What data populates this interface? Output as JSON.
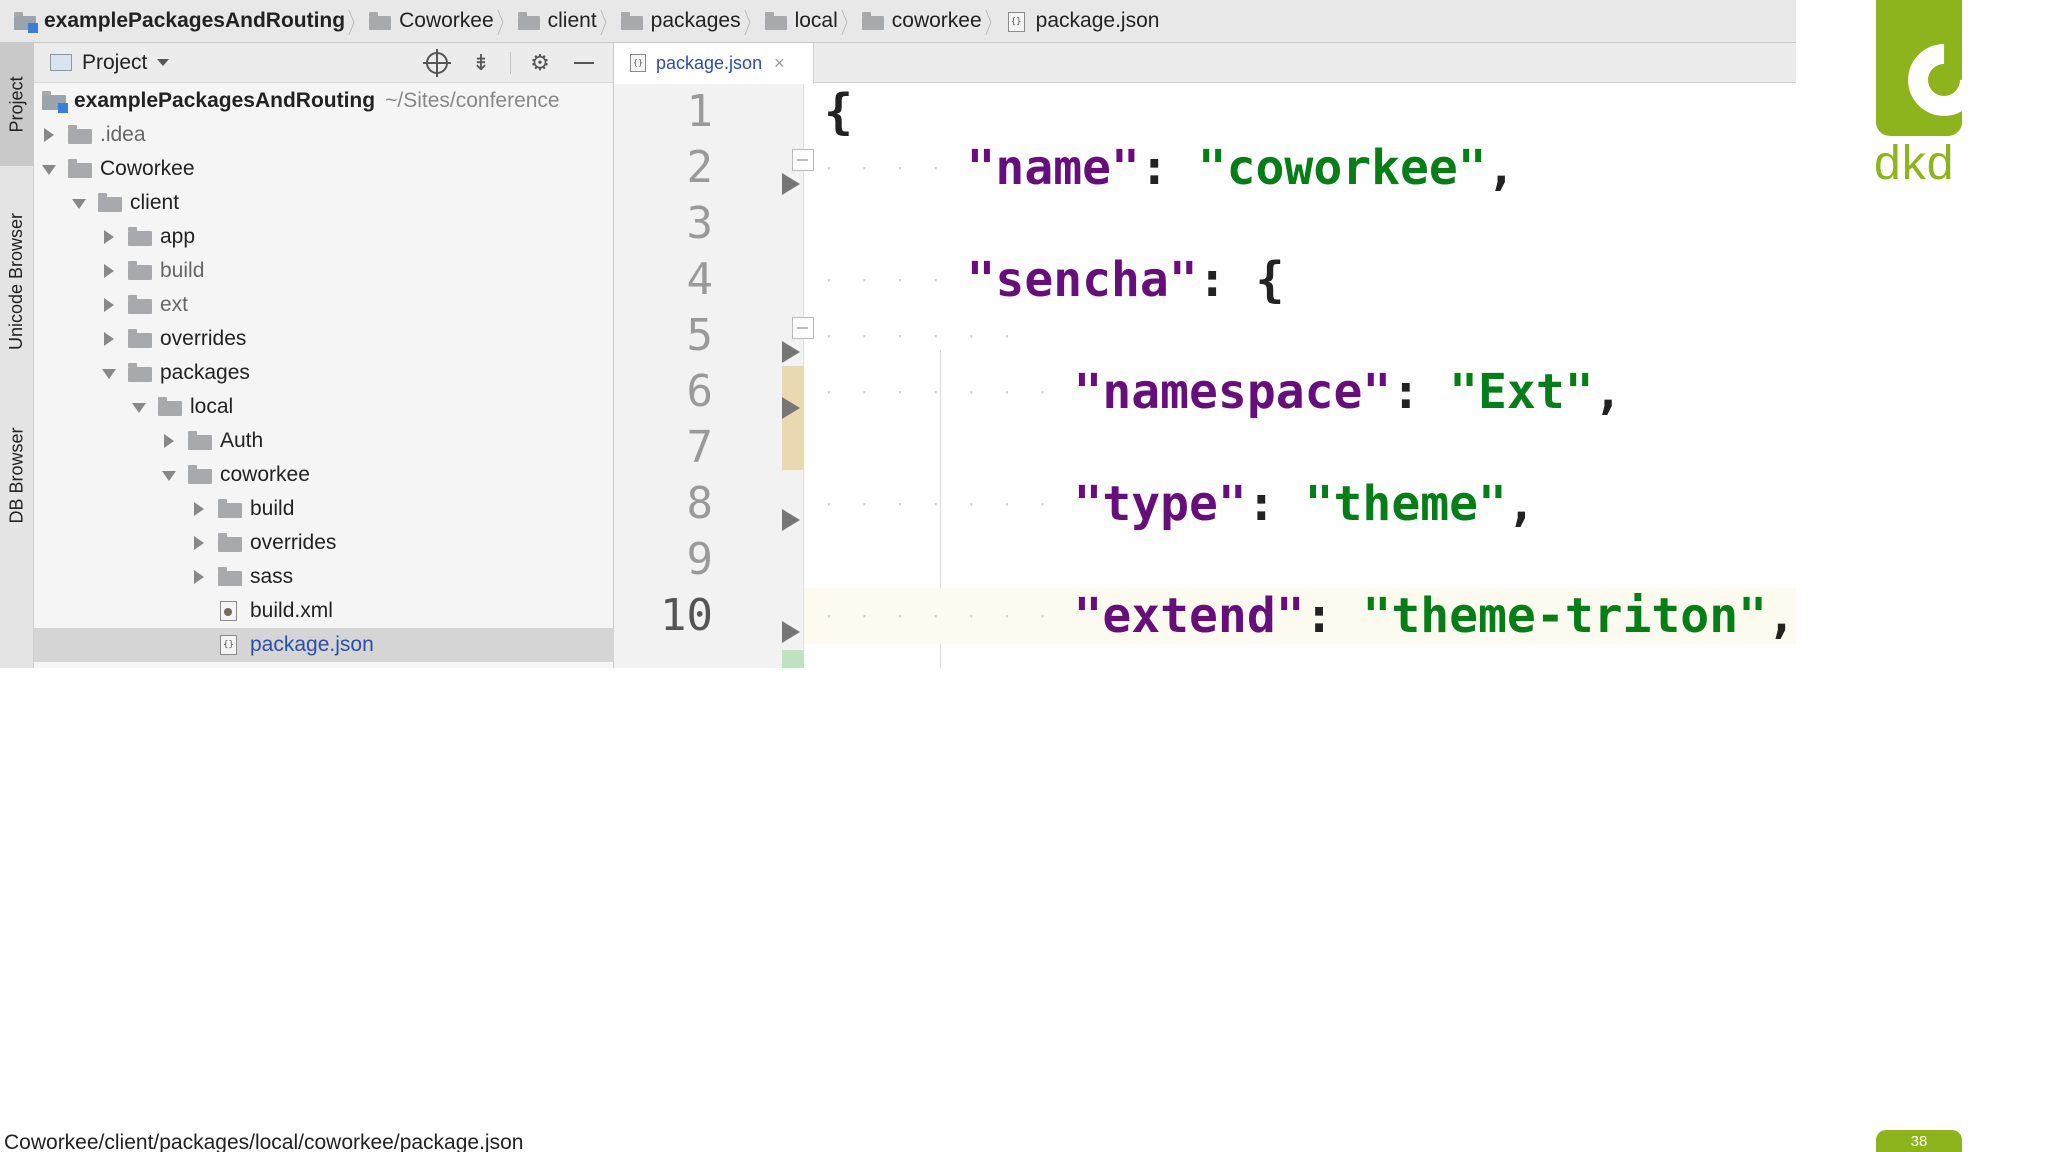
{
  "breadcrumb": [
    {
      "label": "examplePackagesAndRouting",
      "icon": "project-folder-icon"
    },
    {
      "label": "Coworkee",
      "icon": "folder-icon"
    },
    {
      "label": "client",
      "icon": "folder-icon"
    },
    {
      "label": "packages",
      "icon": "folder-icon"
    },
    {
      "label": "local",
      "icon": "folder-icon"
    },
    {
      "label": "coworkee",
      "icon": "folder-icon"
    },
    {
      "label": "package.json",
      "icon": "json-file-icon"
    }
  ],
  "tool_tabs": {
    "project": "Project",
    "unicode_browser": "Unicode Browser",
    "db_browser": "DB Browser"
  },
  "project_panel": {
    "title": "Project",
    "tools": [
      "locate-icon",
      "collapse-all-icon",
      "gear-icon",
      "minimize-icon"
    ]
  },
  "tree": [
    {
      "label": "examplePackagesAndRouting",
      "path": "~/Sites/conference",
      "type": "project",
      "expanded": true
    },
    {
      "label": ".idea",
      "type": "folder",
      "expanded": false
    },
    {
      "label": "Coworkee",
      "type": "folder",
      "expanded": true
    },
    {
      "label": "client",
      "type": "folder",
      "expanded": true
    },
    {
      "label": "app",
      "type": "folder",
      "expanded": false
    },
    {
      "label": "build",
      "type": "folder",
      "expanded": false
    },
    {
      "label": "ext",
      "type": "folder",
      "expanded": false
    },
    {
      "label": "overrides",
      "type": "folder",
      "expanded": false
    },
    {
      "label": "packages",
      "type": "folder",
      "expanded": true
    },
    {
      "label": "local",
      "type": "folder",
      "expanded": true
    },
    {
      "label": "Auth",
      "type": "folder",
      "expanded": false
    },
    {
      "label": "coworkee",
      "type": "folder",
      "expanded": true
    },
    {
      "label": "build",
      "type": "folder",
      "expanded": false
    },
    {
      "label": "overrides",
      "type": "folder",
      "expanded": false
    },
    {
      "label": "sass",
      "type": "folder",
      "expanded": false
    },
    {
      "label": "build.xml",
      "type": "xml-file"
    },
    {
      "label": "package.json",
      "type": "json-file",
      "selected": true
    }
  ],
  "editor": {
    "tab_label": "package.json",
    "tab_close": "×",
    "line_numbers": [
      "1",
      "2",
      "3",
      "4",
      "5",
      "6",
      "7",
      "8",
      "9",
      "10"
    ],
    "current_line": "10",
    "code": {
      "l1_open": "{",
      "l2_key": "\"name\"",
      "l2_colon": ": ",
      "l2_value": "\"coworkee\"",
      "l2_comma": ",",
      "l4_key": "\"sencha\"",
      "l4_colon": ": ",
      "l4_open": "{",
      "l6_key": "\"namespace\"",
      "l6_colon": ": ",
      "l6_value": "\"Ext\"",
      "l6_comma": ",",
      "l8_key": "\"type\"",
      "l8_colon": ": ",
      "l8_value": "\"theme\"",
      "l8_comma": ",",
      "l10_key": "\"extend\"",
      "l10_colon": ": ",
      "l10_value": "\"theme-triton\"",
      "l10_comma": ","
    }
  },
  "slide": {
    "logo_text": "dkd",
    "footer_path": "Coworkee/client/packages/local/coworkee/package.json",
    "page_number": "38"
  },
  "colors": {
    "brand_green": "#8db31d",
    "json_key": "#660e7a",
    "json_string": "#067d17"
  }
}
